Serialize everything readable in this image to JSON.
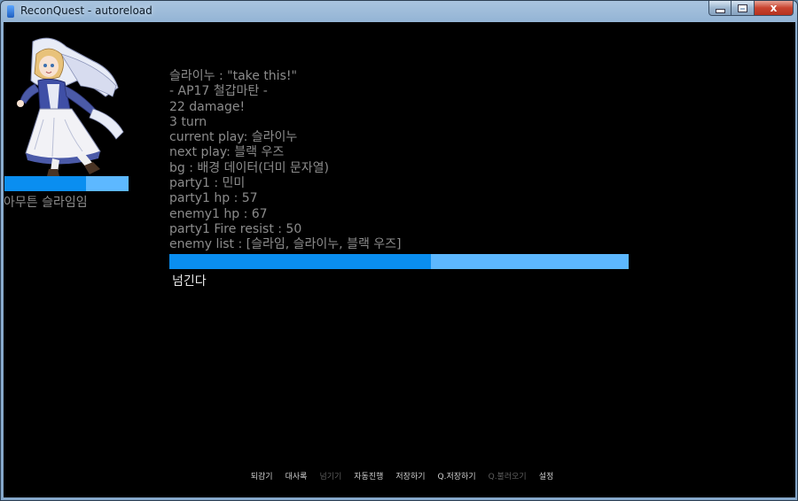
{
  "window": {
    "title": "ReconQuest - autoreload",
    "close_glyph": "x"
  },
  "character": {
    "name": "아무튼 슬라임임",
    "hp_fraction": 0.66
  },
  "log": [
    "슬라이누 : \"take this!\"",
    " - AP17 철갑마탄 -",
    "22 damage!",
    "3 turn",
    "current play: 슬라이누",
    "next play: 블랙 우즈",
    "bg : 배경 데이터(더미 문자열)",
    "party1 : 민미",
    "party1 hp : 57",
    "enemy1 hp : 67",
    "party1 Fire resist : 50",
    "enemy list : [슬라임, 슬라이누, 블랙 우즈]"
  ],
  "progress": {
    "fraction": 0.57
  },
  "skip_label": "넘긴다",
  "menu": [
    {
      "name": "rewind",
      "label": "되감기",
      "enabled": true
    },
    {
      "name": "backlog",
      "label": "대사록",
      "enabled": true
    },
    {
      "name": "skip",
      "label": "넘기기",
      "enabled": false
    },
    {
      "name": "auto",
      "label": "자동진행",
      "enabled": true
    },
    {
      "name": "save",
      "label": "저장하기",
      "enabled": true
    },
    {
      "name": "quick-save",
      "label": "Q.저장하기",
      "enabled": true
    },
    {
      "name": "quick-load",
      "label": "Q.불러오기",
      "enabled": false
    },
    {
      "name": "settings",
      "label": "설정",
      "enabled": true
    }
  ],
  "colors": {
    "bar_fill": "#0a8ef0",
    "bar_track": "#5db8ff",
    "log_text": "#8c8c8c",
    "menu_text": "#cfcfcf",
    "menu_text_disabled": "#5e5e5e"
  }
}
